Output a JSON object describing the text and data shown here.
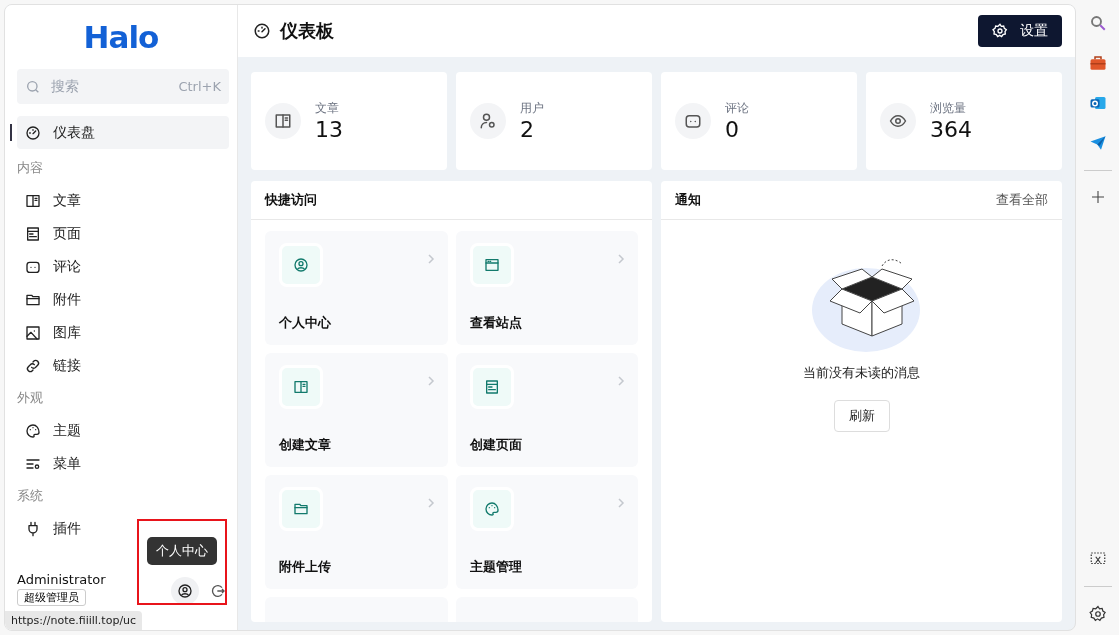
{
  "sidebar": {
    "logo": "Halo",
    "search": {
      "placeholder": "搜索",
      "shortcut": "Ctrl+K"
    },
    "groups": [
      {
        "items": [
          {
            "label": "仪表盘",
            "kind": "gauge",
            "selected": true
          }
        ]
      },
      {
        "title": "内容",
        "items": [
          {
            "label": "文章",
            "kind": "book",
            "selected": false
          },
          {
            "label": "页面",
            "kind": "page",
            "selected": false
          },
          {
            "label": "评论",
            "kind": "comment",
            "selected": false
          },
          {
            "label": "附件",
            "kind": "folder",
            "selected": false
          },
          {
            "label": "图库",
            "kind": "image",
            "selected": false
          },
          {
            "label": "链接",
            "kind": "link",
            "selected": false
          }
        ]
      },
      {
        "title": "外观",
        "items": [
          {
            "label": "主题",
            "kind": "palette",
            "selected": false
          },
          {
            "label": "菜单",
            "kind": "menu",
            "selected": false
          }
        ]
      },
      {
        "title": "系统",
        "items": [
          {
            "label": "插件",
            "kind": "plug",
            "selected": false
          }
        ]
      }
    ],
    "user": {
      "name": "Administrator",
      "role": "超级管理员",
      "tooltip": "个人中心"
    }
  },
  "status_url": "https://note.fiiill.top/uc",
  "header": {
    "title": "仪表板",
    "button": "设置"
  },
  "stats": [
    {
      "label": "文章",
      "value": "13",
      "kind": "book"
    },
    {
      "label": "用户",
      "value": "2",
      "kind": "usergear"
    },
    {
      "label": "评论",
      "value": "0",
      "kind": "comment"
    },
    {
      "label": "浏览量",
      "value": "364",
      "kind": "eye"
    }
  ],
  "quick_access": {
    "title": "快捷访问",
    "tiles": [
      {
        "label": "个人中心",
        "kind": "user"
      },
      {
        "label": "查看站点",
        "kind": "browser"
      },
      {
        "label": "创建文章",
        "kind": "book"
      },
      {
        "label": "创建页面",
        "kind": "page"
      },
      {
        "label": "附件上传",
        "kind": "folder"
      },
      {
        "label": "主题管理",
        "kind": "palette"
      }
    ]
  },
  "notifications": {
    "title": "通知",
    "link": "查看全部",
    "empty_text": "当前没有未读的消息",
    "button": "刷新"
  }
}
